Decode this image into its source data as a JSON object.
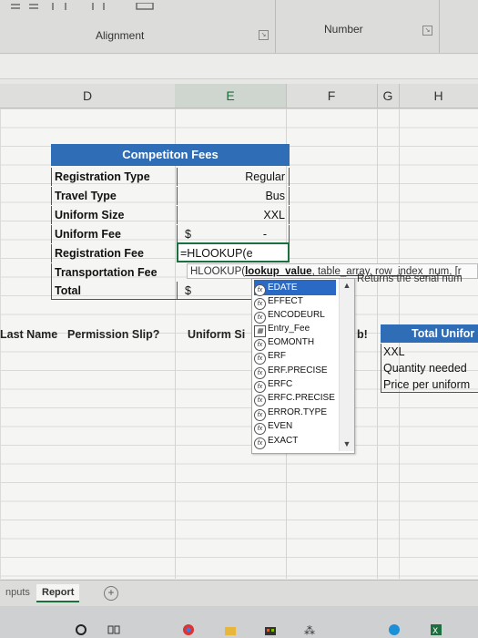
{
  "ribbon": {
    "alignment_label": "Alignment",
    "number_label": "Number",
    "launcher_glyph": "↘"
  },
  "columns": [
    "D",
    "E",
    "F",
    "G",
    "H"
  ],
  "fees_table": {
    "title": "Competiton Fees",
    "rows": [
      {
        "label": "Registration Type",
        "value": "Regular"
      },
      {
        "label": "Travel Type",
        "value": "Bus"
      },
      {
        "label": "Uniform Size",
        "value": "XXL"
      },
      {
        "label": "Uniform Fee",
        "value": "$",
        "dash": "-"
      },
      {
        "label": "Registration Fee",
        "value": "=HLOOKUP(e"
      },
      {
        "label": "Transportation Fee",
        "value": ""
      },
      {
        "label": "Total",
        "value": "$"
      }
    ]
  },
  "tooltip": {
    "fn": "HLOOKUP(",
    "arg1": "lookup_value",
    "rest": ", table_array, row_index_num, [r"
  },
  "autocomplete": {
    "items": [
      "EDATE",
      "EFFECT",
      "ENCODEURL",
      "Entry_Fee",
      "EOMONTH",
      "ERF",
      "ERF.PRECISE",
      "ERFC",
      "ERFC.PRECISE",
      "ERROR.TYPE",
      "EVEN",
      "EXACT"
    ],
    "selected": "EDATE",
    "description": "Returns the serial num"
  },
  "lower_headers": {
    "last_name": "Last Name",
    "permission": "Permission Slip?",
    "uniform": "Uniform Si",
    "partial": "b!"
  },
  "uniform_table": {
    "title": "Total Unifor",
    "rows": [
      "XXL",
      "Quantity needed",
      "Price per uniform"
    ]
  },
  "sheet_tabs": {
    "inputs": "nputs",
    "report": "Report",
    "add": "+"
  },
  "taskbar_icons": [
    "search-icon",
    "task-view-icon",
    "chrome-icon",
    "file-explorer-icon",
    "store-icon",
    "teams-icon",
    "edge-icon",
    "excel-icon"
  ],
  "colors": {
    "header_blue": "#2f6db7",
    "excel_green": "#1d6f3f",
    "selection_blue": "#2a69c4"
  }
}
